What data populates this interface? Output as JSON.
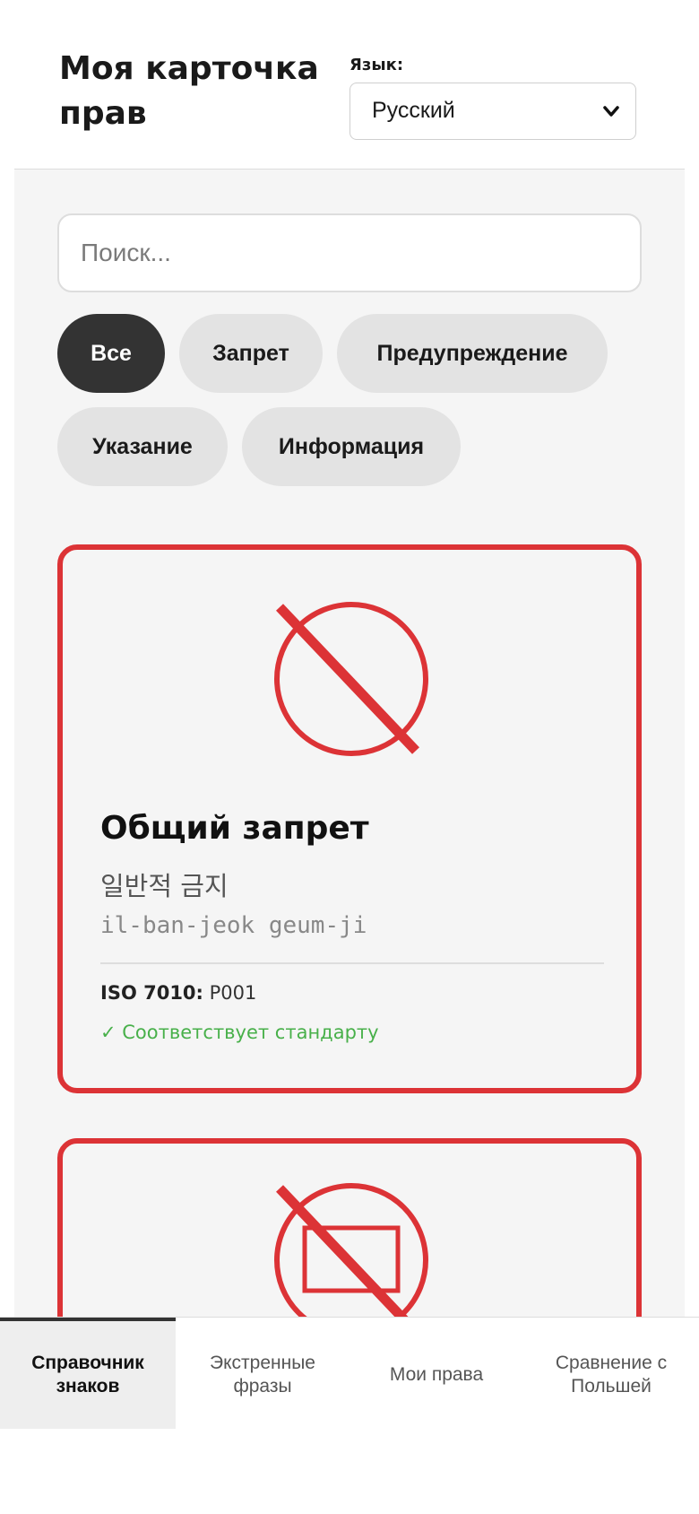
{
  "header": {
    "title": "Моя карточка прав",
    "language_label": "Язык:",
    "language_value": "Русский"
  },
  "search": {
    "placeholder": "Поиск..."
  },
  "filters": [
    {
      "label": "Все",
      "active": true
    },
    {
      "label": "Запрет",
      "active": false
    },
    {
      "label": "Предупреждение",
      "active": false
    },
    {
      "label": "Указание",
      "active": false
    },
    {
      "label": "Информация",
      "active": false
    }
  ],
  "cards": [
    {
      "icon": "general-prohibition-icon",
      "title": "Общий запрет",
      "korean": "일반적 금지",
      "romanization": "il-ban-jeok geum-ji",
      "iso_label": "ISO 7010:",
      "iso_code": "P001",
      "compliance": "✓ Соответствует стандарту"
    },
    {
      "icon": "prohibition-rectangle-icon"
    }
  ],
  "bottom_nav": [
    {
      "label": "Справочник знаков",
      "active": true
    },
    {
      "label": "Экстренные фразы",
      "active": false
    },
    {
      "label": "Мои права",
      "active": false
    },
    {
      "label": "Сравнение с Польшей",
      "active": false
    }
  ],
  "colors": {
    "prohibition_red": "#dc3336",
    "compliance_green": "#48b04a",
    "active_chip": "#333333"
  }
}
